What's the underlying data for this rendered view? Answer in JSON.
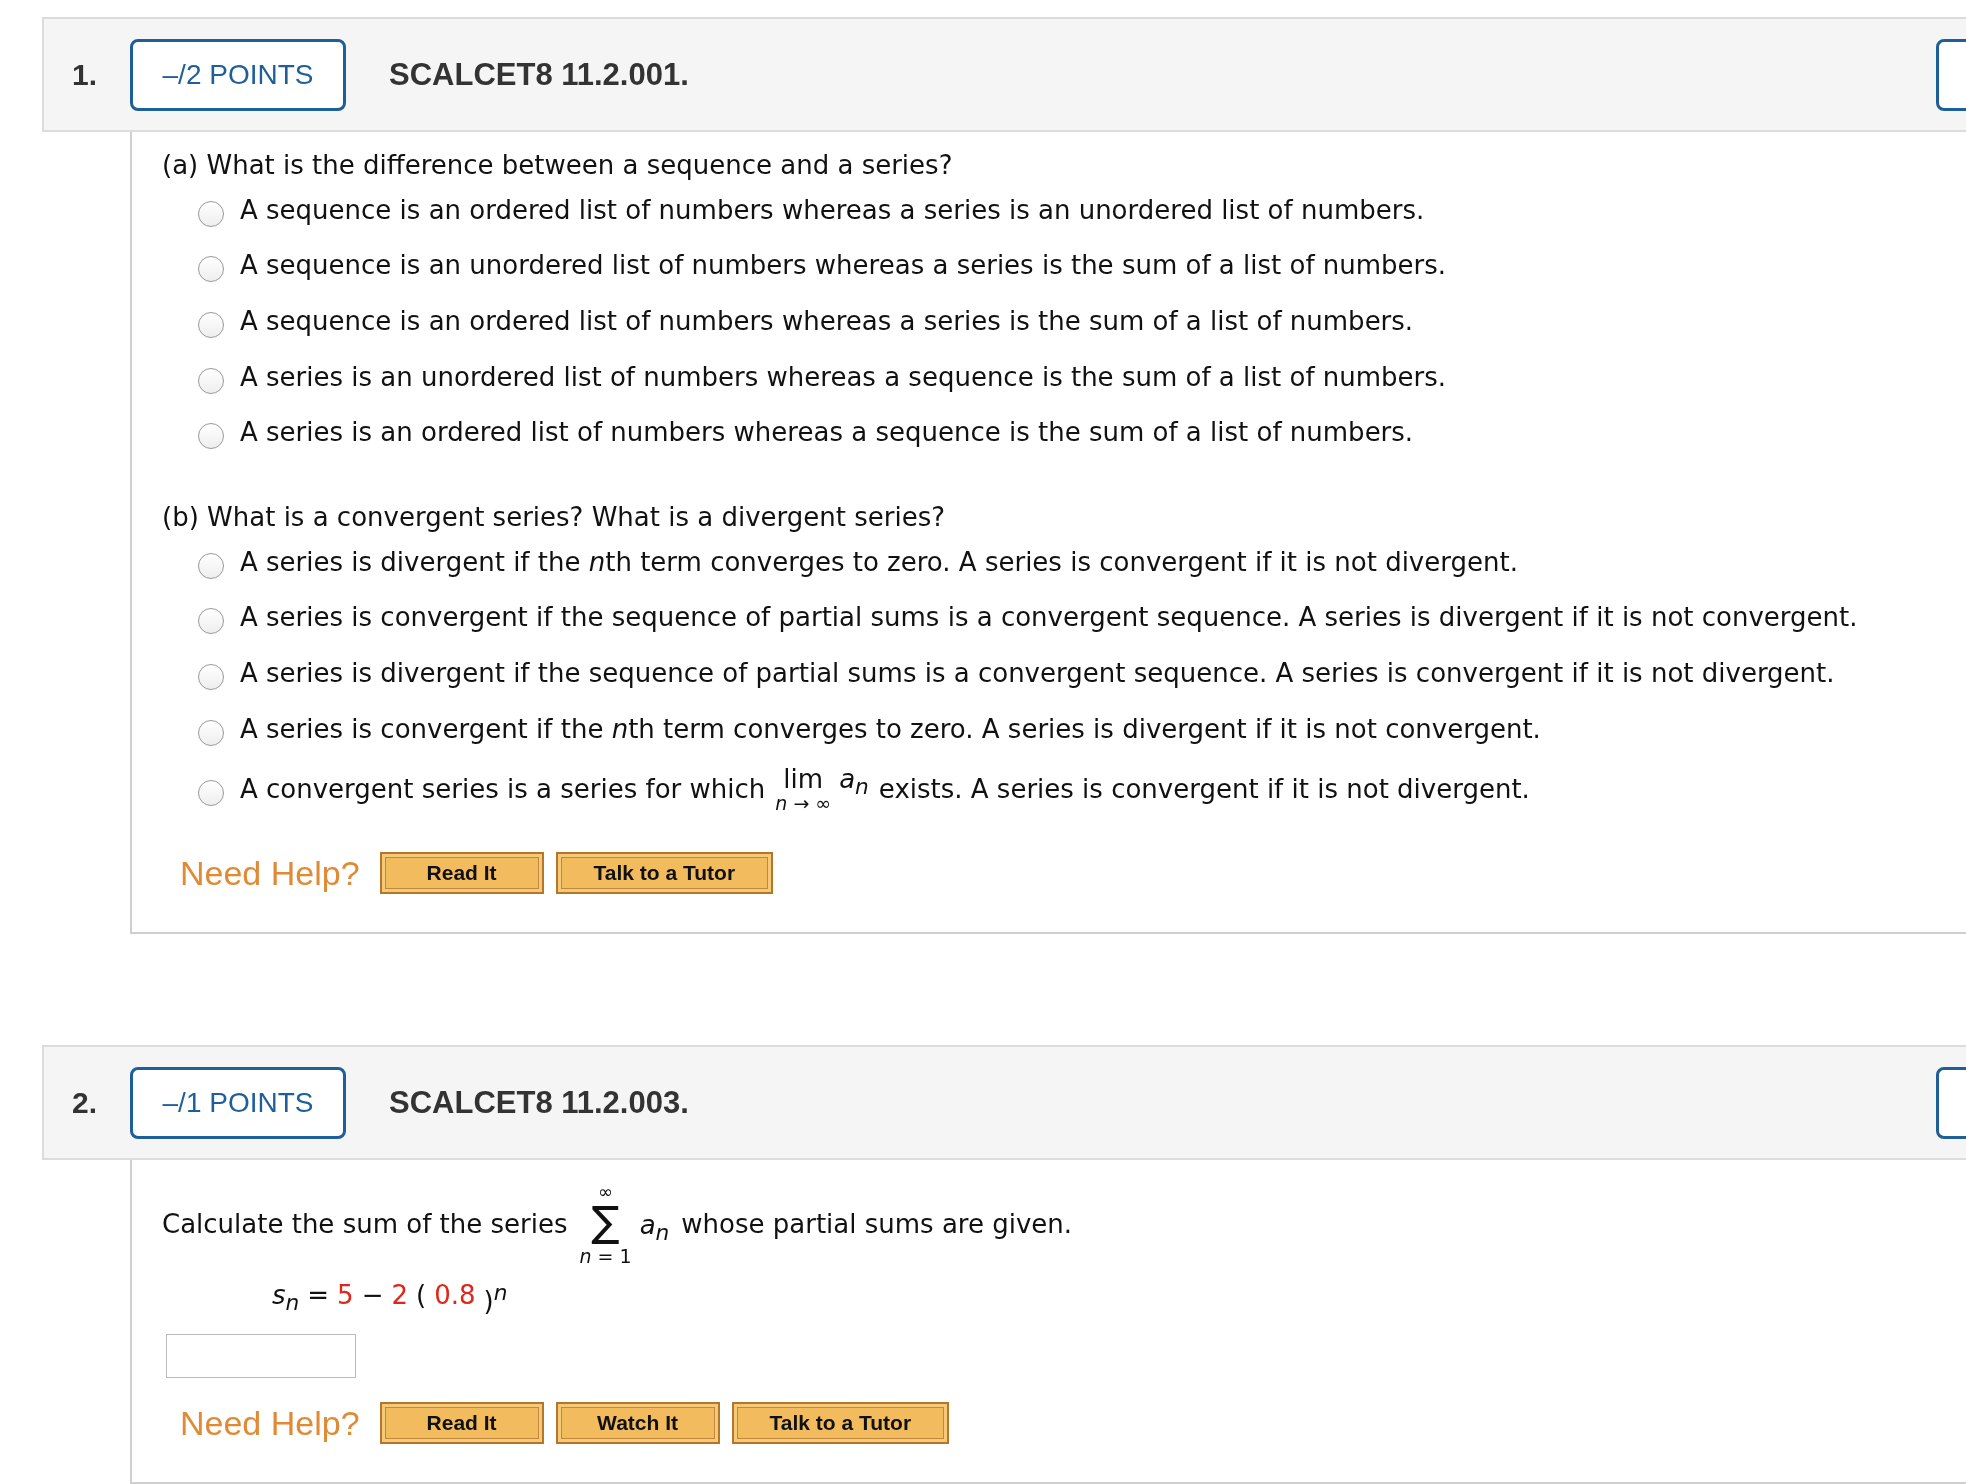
{
  "questions": [
    {
      "number": "1.",
      "points": "–/2 POINTS",
      "code": "SCALCET8 11.2.001.",
      "parts": [
        {
          "prompt": "(a) What is the difference between a sequence and a series?",
          "options": [
            {
              "kind": "text",
              "segments": [
                {
                  "kind": "plain",
                  "text": "A sequence is an ordered list of numbers whereas a series is an unordered list of numbers."
                }
              ],
              "selected": false
            },
            {
              "kind": "text",
              "segments": [
                {
                  "kind": "plain",
                  "text": "A sequence is an unordered list of numbers whereas a series is the sum of a list of numbers."
                }
              ],
              "selected": false
            },
            {
              "kind": "text",
              "segments": [
                {
                  "kind": "plain",
                  "text": "A sequence is an ordered list of numbers whereas a series is the sum of a list of numbers."
                }
              ],
              "selected": false
            },
            {
              "kind": "text",
              "segments": [
                {
                  "kind": "plain",
                  "text": "A series is an unordered list of numbers whereas a sequence is the sum of a list of numbers."
                }
              ],
              "selected": false
            },
            {
              "kind": "text",
              "segments": [
                {
                  "kind": "plain",
                  "text": "A series is an ordered list of numbers whereas a sequence is the sum of a list of numbers."
                }
              ],
              "selected": false
            }
          ]
        },
        {
          "prompt": "(b) What is a convergent series? What is a divergent series?",
          "options": [
            {
              "kind": "text",
              "segments": [
                {
                  "kind": "plain",
                  "text": "A series is divergent if the "
                },
                {
                  "kind": "var",
                  "text": "n"
                },
                {
                  "kind": "plain",
                  "text": "th term converges to zero. A series is convergent if it is not divergent."
                }
              ],
              "selected": false
            },
            {
              "kind": "text",
              "segments": [
                {
                  "kind": "plain",
                  "text": "A series is convergent if the sequence of partial sums is a convergent sequence. A series is divergent if it is not convergent."
                }
              ],
              "selected": false
            },
            {
              "kind": "text",
              "segments": [
                {
                  "kind": "plain",
                  "text": "A series is divergent if the sequence of partial sums is a convergent sequence. A series is convergent if it is not divergent."
                }
              ],
              "selected": false
            },
            {
              "kind": "text",
              "segments": [
                {
                  "kind": "plain",
                  "text": "A series is convergent if the "
                },
                {
                  "kind": "var",
                  "text": "n"
                },
                {
                  "kind": "plain",
                  "text": "th term converges to zero. A series is divergent if it is not convergent."
                }
              ],
              "selected": false
            },
            {
              "kind": "limit",
              "before": "A convergent series is a series for which",
              "lim": "lim",
              "lim_var": "n",
              "lim_rest": "→ ∞",
              "term": "a",
              "term_sub": "n",
              "after": "exists. A series is convergent if it is not divergent.",
              "selected": false
            }
          ]
        }
      ],
      "help": {
        "label": "Need Help?",
        "buttons": [
          "Read It",
          "Talk to a Tutor"
        ]
      }
    },
    {
      "number": "2.",
      "points": "–/1 POINTS",
      "code": "SCALCET8 11.2.003.",
      "statement": {
        "before": "Calculate the sum of the series",
        "sum_top": "∞",
        "sum_symbol": "∑",
        "sum_var": "n",
        "sum_rest": "= 1",
        "term": "a",
        "term_sub": "n",
        "after": "whose partial sums are given."
      },
      "formula": [
        {
          "kind": "var",
          "text": "s",
          "sub": "n"
        },
        {
          "kind": "plain",
          "text": "="
        },
        {
          "kind": "given",
          "text": "5"
        },
        {
          "kind": "plain",
          "text": "−"
        },
        {
          "kind": "given",
          "text": "2"
        },
        {
          "kind": "plain",
          "text": "("
        },
        {
          "kind": "given",
          "text": "0.8"
        },
        {
          "kind": "plain",
          "text": ")",
          "sup": "n"
        }
      ],
      "help": {
        "label": "Need Help?",
        "buttons": [
          "Read It",
          "Watch It",
          "Talk to a Tutor"
        ]
      }
    }
  ]
}
